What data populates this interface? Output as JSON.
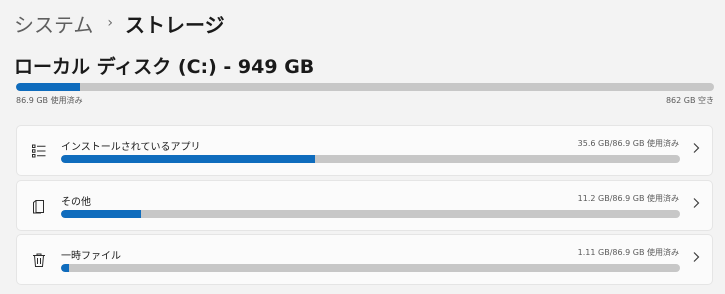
{
  "breadcrumb": {
    "parent": "システム",
    "separator": "›",
    "current": "ストレージ"
  },
  "disk": {
    "title": "ローカル ディスク (C:) - 949 GB",
    "used_label": "86.9 GB 使用済み",
    "free_label": "862 GB 空き",
    "used_fraction": 0.0916
  },
  "categories": [
    {
      "label": "インストールされているアプリ",
      "usage": "35.6 GB/86.9 GB 使用済み",
      "fraction": 0.4097,
      "icon": "apps-list-icon"
    },
    {
      "label": "その他",
      "usage": "11.2 GB/86.9 GB 使用済み",
      "fraction": 0.1289,
      "icon": "other-files-icon"
    },
    {
      "label": "一時ファイル",
      "usage": "1.11 GB/86.9 GB 使用済み",
      "fraction": 0.0128,
      "icon": "trash-icon"
    }
  ],
  "colors": {
    "accent": "#0f6cbd",
    "track": "#c7c7c7",
    "background": "#f3f3f3",
    "card": "#fbfbfb"
  }
}
